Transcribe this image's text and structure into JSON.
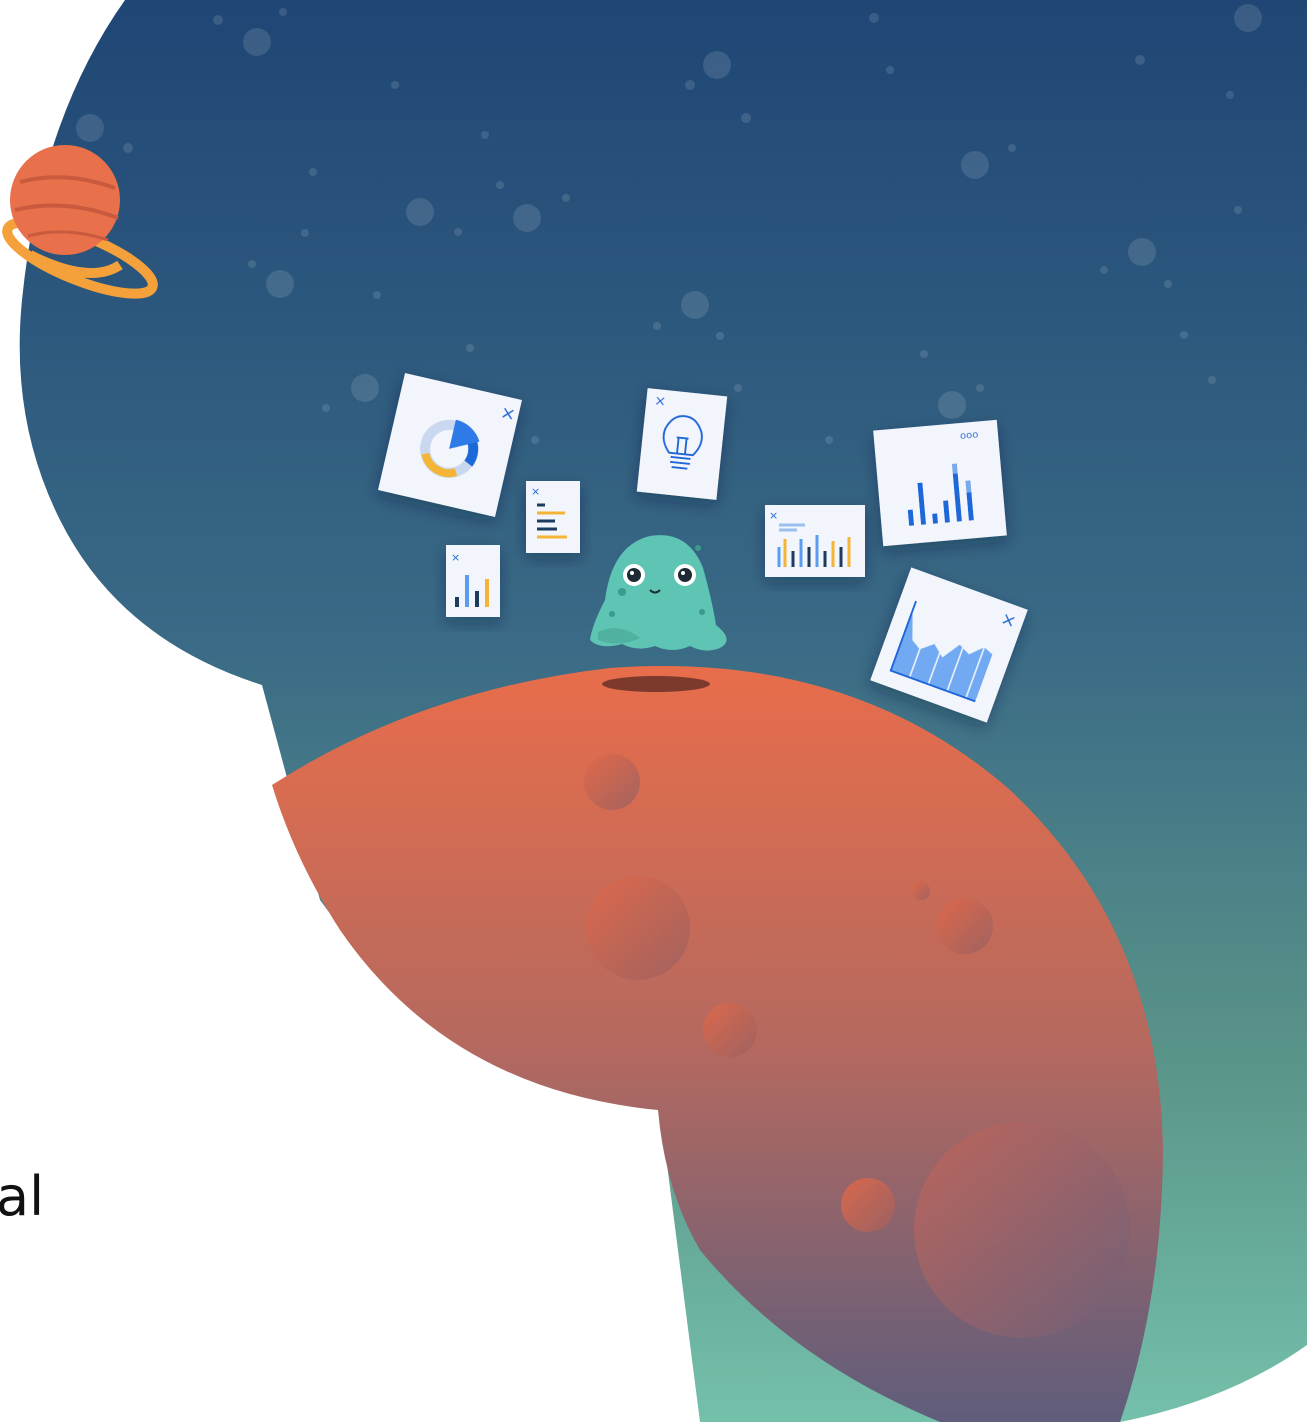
{
  "page_text": {
    "cut_off_word_fragment": "al"
  },
  "colors": {
    "sky_top": "#1f4675",
    "sky_mid": "#3f6f86",
    "sky_bottom": "#74c0ab",
    "planet_top": "#e86d4b",
    "planet_bottom": "#5f5d7c",
    "saturn": "#e8704b",
    "saturn_ring": "#f5a13b",
    "blob": "#5ec4b3",
    "card_bg": "#f2f6fc",
    "accent_blue": "#1f67d9",
    "accent_yellow": "#f4b436"
  },
  "icons": {
    "card_close": "close-icon",
    "card_menu": "more-dots-icon",
    "lightbulb": "lightbulb-icon",
    "donut": "donut-chart-icon",
    "bars": "bar-chart-icon",
    "area": "area-chart-icon",
    "list": "list-chart-icon"
  },
  "card_labels": {
    "close": "×",
    "menu": "ooo"
  }
}
